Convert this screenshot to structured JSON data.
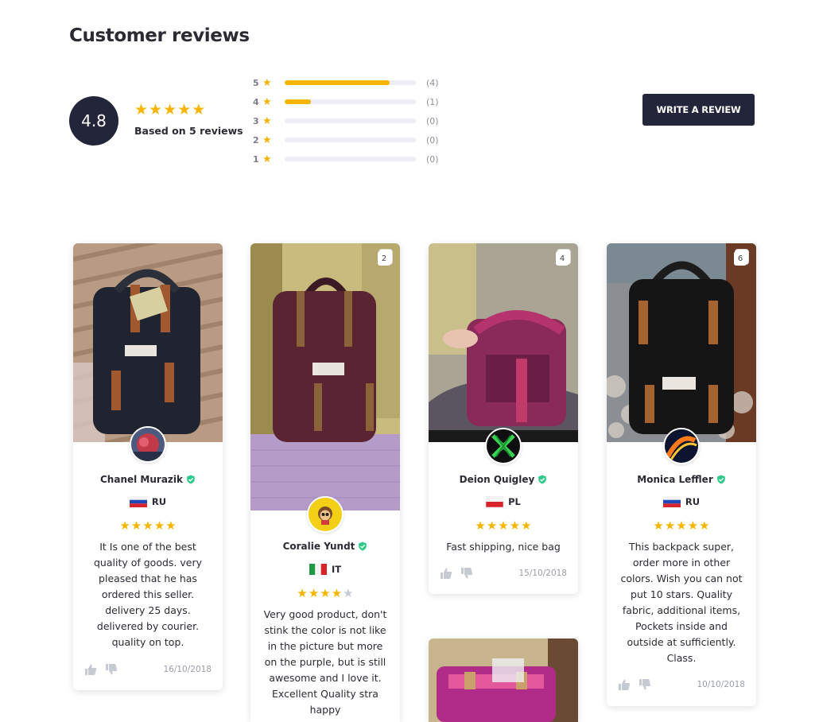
{
  "page": {
    "title": "Customer reviews"
  },
  "summary": {
    "average": "4.8",
    "rating": 4.8,
    "based_on": "Based on 5 reviews",
    "accent_color": "#f7b500",
    "dark_color": "#23253a"
  },
  "distribution": [
    {
      "stars": "5",
      "count": "(4)",
      "fraction": 0.8
    },
    {
      "stars": "4",
      "count": "(1)",
      "fraction": 0.2
    },
    {
      "stars": "3",
      "count": "(0)",
      "fraction": 0
    },
    {
      "stars": "2",
      "count": "(0)",
      "fraction": 0
    },
    {
      "stars": "1",
      "count": "(0)",
      "fraction": 0
    }
  ],
  "actions": {
    "write_review": "WRITE A REVIEW"
  },
  "reviews": [
    {
      "name": "Chanel Murazik",
      "country": "RU",
      "flag": "russia-flag",
      "rating": 5,
      "text": "It Is one of the best quality of goods. very pleased that he has ordered this seller. delivery 25 days. delivered by courier. quality on top.",
      "date": "16/10/2018",
      "photo_count": "",
      "photo_subject": "black-backpack-photo",
      "avatar": "red-abstract-avatar"
    },
    {
      "name": "Coralie Yundt",
      "country": "IT",
      "flag": "italy-flag",
      "rating": 4,
      "text": "Very good product, don't stink the color is not like in the picture but more on the purple, but is still awesome and I love it. Excellent Quality stra happy",
      "date": "",
      "photo_count": "2",
      "photo_subject": "plum-backpack-photo",
      "avatar": "cartoon-face-avatar"
    },
    {
      "name": "Deion Quigley",
      "country": "PL",
      "flag": "poland-flag",
      "rating": 5,
      "text": "Fast shipping, nice bag",
      "date": "15/10/2018",
      "photo_count": "4",
      "photo_subject": "open-purple-backpack-photo",
      "avatar": "green-x-avatar"
    },
    {
      "name": "Monica Leffler",
      "country": "RU",
      "flag": "russia-flag",
      "rating": 5,
      "text": "This backpack super, order more in other colors. Wish you can not put 10 stars. Quality fabric, additional items, Pockets inside and outside at sufficiently. Class.",
      "date": "10/10/2018",
      "photo_count": "6",
      "photo_subject": "black-backpack-rug-photo",
      "avatar": "fire-swirl-avatar"
    }
  ]
}
